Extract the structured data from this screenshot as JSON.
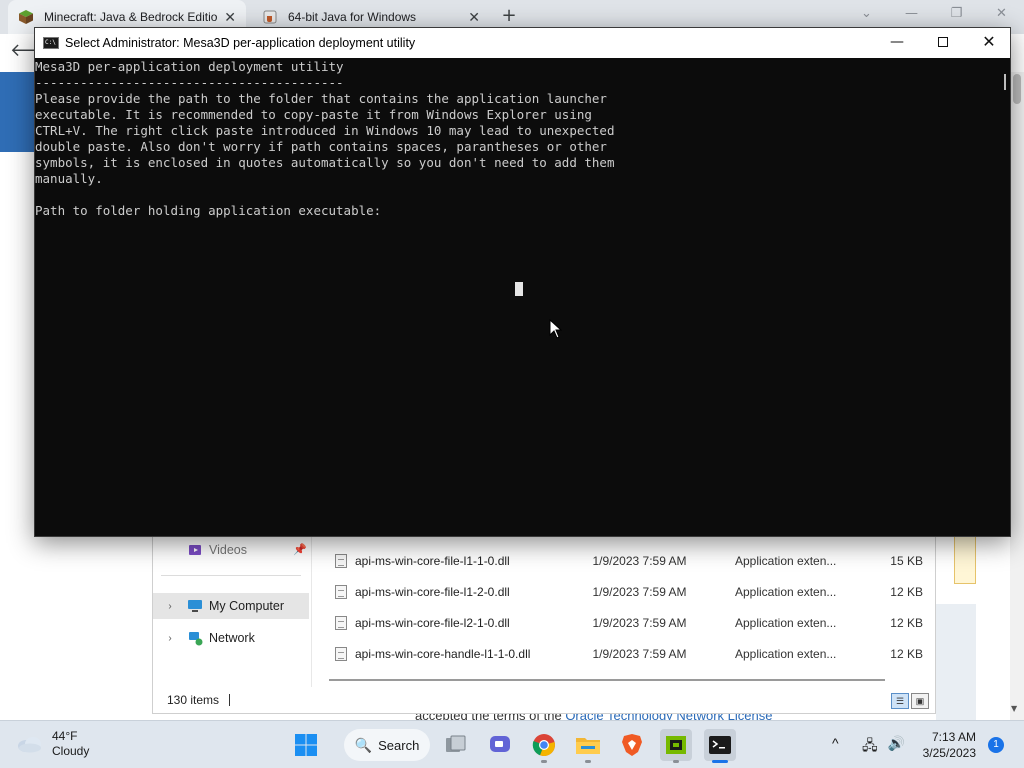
{
  "browser": {
    "tabs": [
      {
        "label": "Minecraft: Java & Bedrock Edition",
        "close": "✕",
        "icon": "minecraft-grass-block-icon"
      },
      {
        "label": "64-bit Java for Windows",
        "close": "✕",
        "icon": "java-cup-icon"
      }
    ],
    "new_tab": "+",
    "back": "🡐"
  },
  "background_page": {
    "text_before_link": "accepted the terms of the ",
    "link_text": "Oracle Technology Network License"
  },
  "explorer": {
    "nav": [
      {
        "label": "Videos",
        "icon": "videos-icon"
      },
      {
        "label": "My Computer",
        "icon": "computer-icon",
        "chevron": "›"
      },
      {
        "label": "Network",
        "icon": "network-icon",
        "chevron": "›"
      }
    ],
    "pin": "📌",
    "files": [
      {
        "name": "api-ms-win-core-file-l1-1-0.dll",
        "date": "1/9/2023 7:59 AM",
        "type": "Application exten...",
        "size": "15 KB"
      },
      {
        "name": "api-ms-win-core-file-l1-2-0.dll",
        "date": "1/9/2023 7:59 AM",
        "type": "Application exten...",
        "size": "12 KB"
      },
      {
        "name": "api-ms-win-core-file-l2-1-0.dll",
        "date": "1/9/2023 7:59 AM",
        "type": "Application exten...",
        "size": "12 KB"
      },
      {
        "name": "api-ms-win-core-handle-l1-1-0.dll",
        "date": "1/9/2023 7:59 AM",
        "type": "Application exten...",
        "size": "12 KB"
      }
    ],
    "status": "130 items"
  },
  "console": {
    "title": "Select Administrator:  Mesa3D per-application deployment utility",
    "controls": {
      "minimize": "—",
      "close": "✕"
    },
    "lines": [
      "Mesa3D per-application deployment utility",
      "-----------------------------------------",
      "Please provide the path to the folder that contains the application launcher",
      "executable. It is recommended to copy-paste it from Windows Explorer using",
      "CTRL+V. The right click paste introduced in Windows 10 may lead to unexpected",
      "double paste. Also don't worry if path contains spaces, parantheses or other",
      "symbols, it is enclosed in quotes automatically so you don't need to add them",
      "manually.",
      "",
      "Path to folder holding application executable:"
    ]
  },
  "taskbar": {
    "weather": {
      "temp": "44°F",
      "condition": "Cloudy"
    },
    "search_label": "Search",
    "search_glyph": "🔍",
    "tray_chevron": "^",
    "time": "7:13 AM",
    "date": "3/25/2023",
    "notifications": "1"
  },
  "colors": {
    "console_bg": "#0c0c0c",
    "console_text": "#cccccc",
    "taskbar_bg": "#dfe6ee",
    "accent": "#1a73e8"
  }
}
